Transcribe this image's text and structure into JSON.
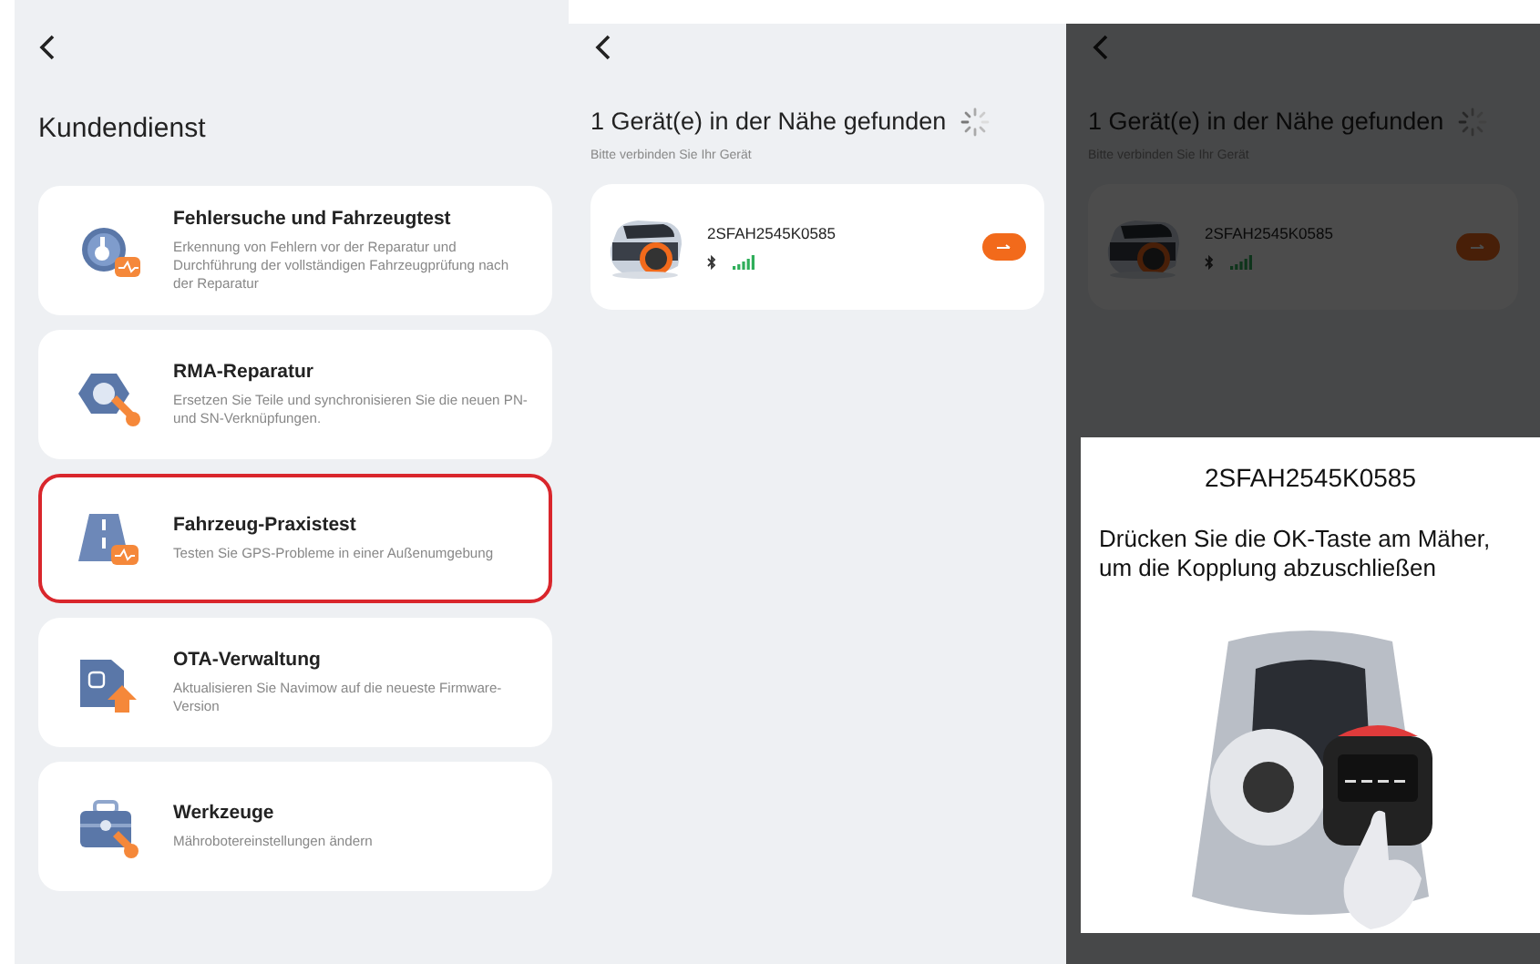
{
  "service_screen": {
    "title": "Kundendienst",
    "items": [
      {
        "kind": "diagnose",
        "title": "Fehlersuche und Fahrzeugtest",
        "description": "Erkennung von Fehlern vor der Reparatur und Durchführung der vollständigen Fahrzeugprüfung nach der Reparatur",
        "highlighted": false
      },
      {
        "kind": "repair",
        "title": "RMA-Reparatur",
        "description": "Ersetzen Sie Teile und synchronisieren Sie die neuen PN- und SN-Verknüpfungen.",
        "highlighted": false
      },
      {
        "kind": "road",
        "title": "Fahrzeug-Praxistest",
        "description": "Testen Sie GPS-Probleme in einer Außenumgebung",
        "highlighted": true
      },
      {
        "kind": "update",
        "title": "OTA-Verwaltung",
        "description": "Aktualisieren Sie Navimow auf die neueste Firmware-Version",
        "highlighted": false
      },
      {
        "kind": "tools",
        "title": "Werkzeuge",
        "description": "Mährobotereinstellungen ändern",
        "highlighted": false
      }
    ]
  },
  "scan_screen": {
    "title": "1 Gerät(e) in der Nähe gefunden",
    "subtitle": "Bitte verbinden Sie Ihr Gerät",
    "devices": [
      {
        "name": "2SFAH2545K0585"
      }
    ]
  },
  "pairing_screen": {
    "background": {
      "title": "1 Gerät(e) in der Nähe gefunden",
      "subtitle": "Bitte verbinden Sie Ihr Gerät",
      "devices": [
        {
          "name": "2SFAH2545K0585"
        }
      ]
    },
    "dialog": {
      "title": "2SFAH2545K0585",
      "message": "Drücken Sie die OK-Taste am Mäher, um die Kopplung abzuschließen"
    }
  }
}
